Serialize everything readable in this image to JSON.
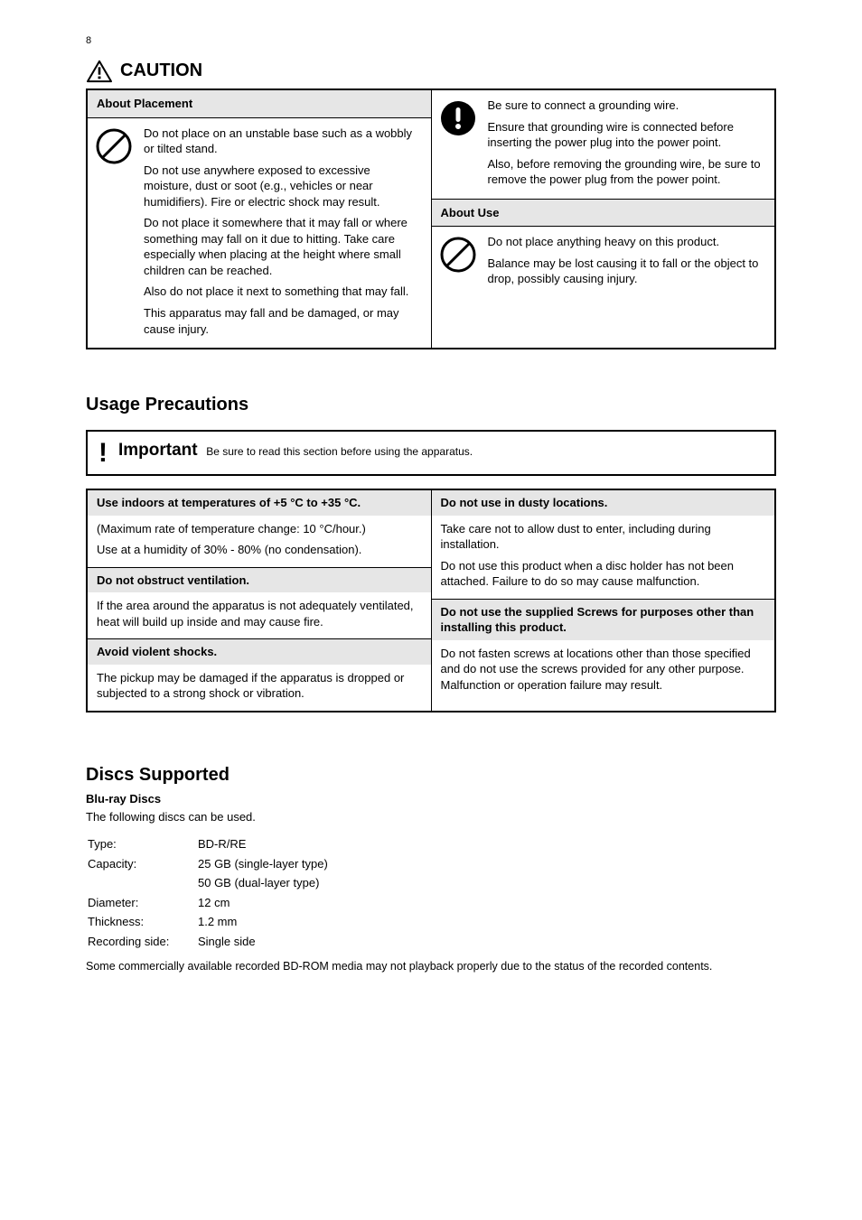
{
  "pageNumber": "8",
  "caution": {
    "heading": "CAUTION",
    "left": {
      "header": "About Placement",
      "paragraphs": [
        "Do not place on an unstable base such as a wobbly or tilted stand.",
        "Do not use anywhere exposed to excessive moisture, dust or soot (e.g., vehicles or near humidifiers). Fire or electric shock may result.",
        "Do not place it somewhere that it may fall or where something may fall on it due to hitting. Take care especially when placing at the height where small children can be reached.",
        "Also do not place it next to something that may fall.",
        "This apparatus may fall and be damaged, or may cause injury."
      ]
    },
    "rightTop": {
      "paragraphs": [
        "Be sure to connect a grounding wire.",
        "Ensure that grounding wire is connected before inserting the power plug into the power point.",
        "Also, before removing the grounding wire, be sure to remove the power plug from the power point."
      ]
    },
    "rightBottom": {
      "header": "About Use",
      "paragraphs": [
        "Do not place anything heavy on this product.",
        "Balance may be lost causing it to fall or the object to drop, possibly causing injury."
      ]
    }
  },
  "usage": {
    "heading": "Usage Precautions",
    "important": {
      "label": "Important",
      "sub": "Be sure to read this section before using the apparatus."
    },
    "left": [
      {
        "header": "Use indoors at temperatures of +5 °C to +35 °C.",
        "body": [
          "(Maximum rate of temperature change: 10 °C/hour.)",
          "Use at a humidity of 30% - 80% (no condensation)."
        ]
      },
      {
        "header": "Do not obstruct ventilation.",
        "body": [
          "If the area around the apparatus is not adequately ventilated, heat will build up inside and may cause fire."
        ]
      },
      {
        "header": "Avoid violent shocks.",
        "body": [
          "The pickup may be damaged if the apparatus is dropped or subjected to a strong shock or vibration."
        ]
      }
    ],
    "right": [
      {
        "header": "Do not use in dusty locations.",
        "body": [
          "Take care not to allow dust to enter, including during installation.",
          "Do not use this product when a disc holder has not been attached. Failure to do so may cause malfunction."
        ]
      },
      {
        "header": "Do not use the supplied Screws for purposes other than installing this product.",
        "body": [
          "Do not fasten screws at locations other than those specified and do not use the screws provided for any other purpose. Malfunction or operation failure may result."
        ]
      }
    ]
  },
  "discs": {
    "heading": "Discs Supported",
    "sub": "Blu-ray Discs",
    "intro": "The following discs can be used.",
    "rows": [
      {
        "label": "Type:",
        "value": "BD-R/RE"
      },
      {
        "label": "Capacity:",
        "value": "25 GB (single-layer type)"
      },
      {
        "label": "",
        "value": "50 GB (dual-layer type)"
      },
      {
        "label": "Diameter:",
        "value": "12 cm"
      },
      {
        "label": "Thickness:",
        "value": "1.2 mm"
      },
      {
        "label": "Recording side:",
        "value": "Single side"
      }
    ],
    "note": "Some commercially available recorded BD-ROM media may not playback properly due to the status of the recorded contents."
  }
}
